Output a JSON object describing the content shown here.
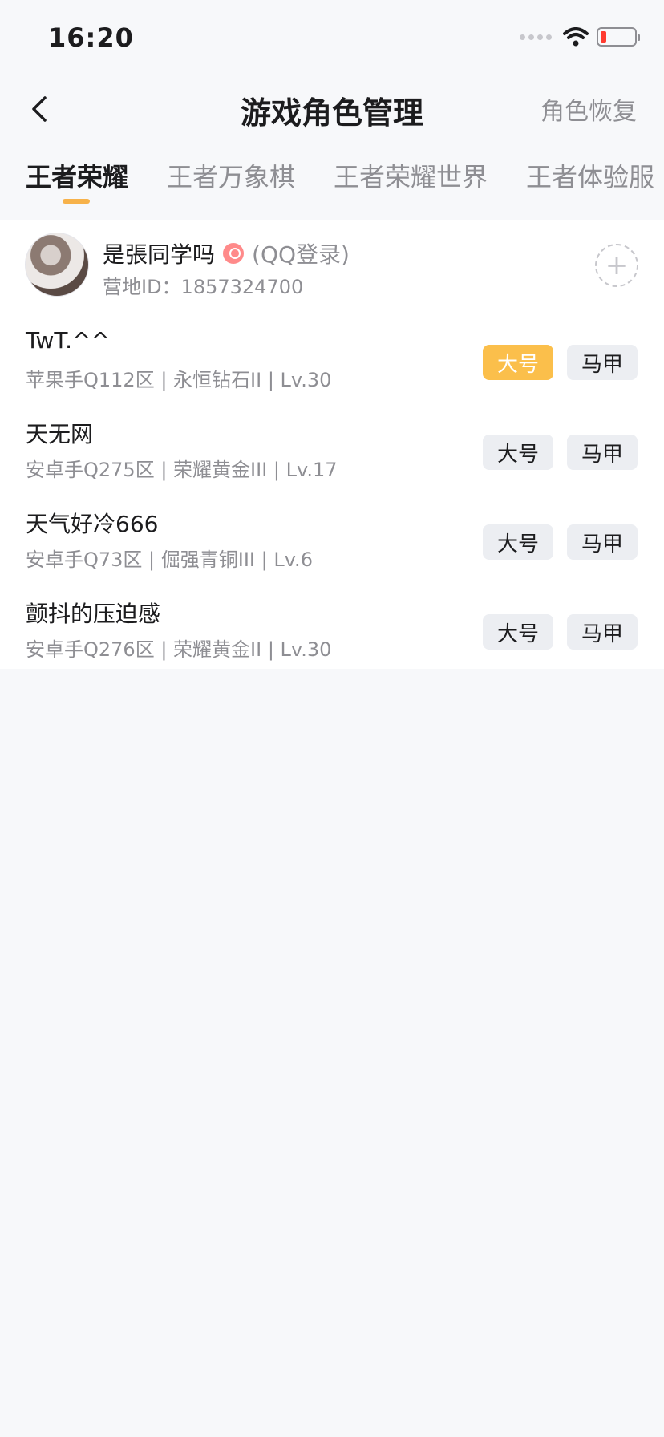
{
  "status": {
    "time": "16:20"
  },
  "nav": {
    "title": "游戏角色管理",
    "right_label": "角色恢复"
  },
  "tabs": [
    {
      "label": "王者荣耀",
      "active": true
    },
    {
      "label": "王者万象棋",
      "active": false
    },
    {
      "label": "王者荣耀世界",
      "active": false
    },
    {
      "label": "王者体验服",
      "active": false
    }
  ],
  "account": {
    "name": "是張同学吗",
    "login_type": "(QQ登录)",
    "camp_id": "营地ID：1857324700",
    "add_icon": "+"
  },
  "roles": [
    {
      "name": "TwT.^^",
      "meta": "苹果手Q112区 | 永恒钻石II | Lv.30",
      "main_label": "大号",
      "alt_label": "马甲",
      "main_selected": true
    },
    {
      "name": "天无网",
      "meta": "安卓手Q275区 | 荣耀黄金III | Lv.17",
      "main_label": "大号",
      "alt_label": "马甲",
      "main_selected": false
    },
    {
      "name": "天气好冷666",
      "meta": "安卓手Q73区 | 倔强青铜III | Lv.6",
      "main_label": "大号",
      "alt_label": "马甲",
      "main_selected": false
    },
    {
      "name": "颤抖的压迫感",
      "meta": "安卓手Q276区 | 荣耀黄金II | Lv.30",
      "main_label": "大号",
      "alt_label": "马甲",
      "main_selected": false
    }
  ],
  "colors": {
    "accent": "#fbbf4b",
    "indicator": "#f7b24a",
    "muted_text": "#8e8e93",
    "background": "#f7f8fa"
  }
}
